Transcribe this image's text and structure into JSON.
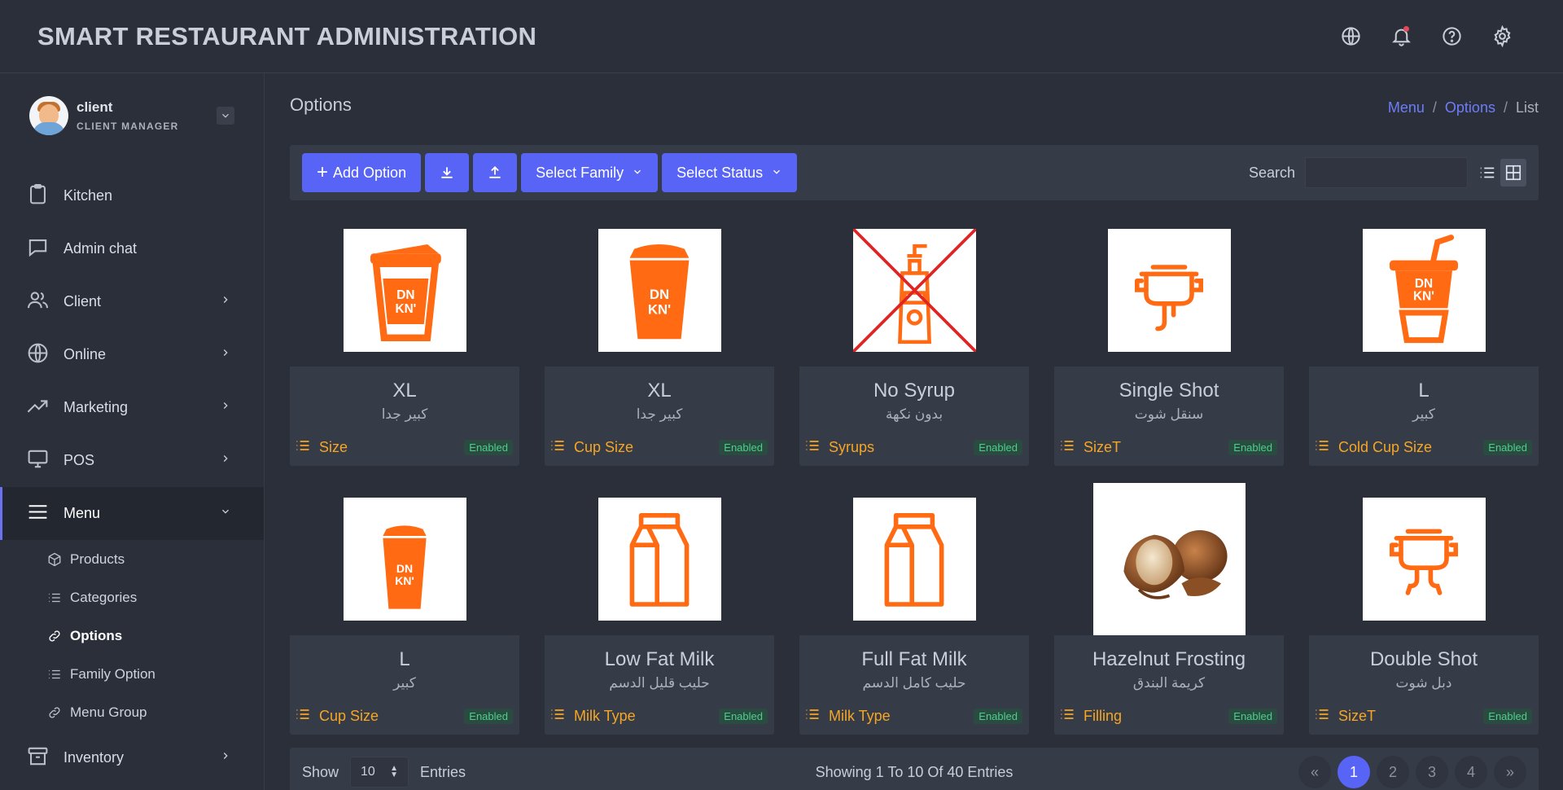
{
  "app": {
    "title": "SMART RESTAURANT ADMINISTRATION"
  },
  "header": {
    "icons": [
      "globe-icon",
      "bell-icon",
      "help-icon",
      "gear-icon"
    ]
  },
  "user": {
    "name": "client",
    "role": "CLIENT MANAGER"
  },
  "sidebar": {
    "items": [
      {
        "label": "Kitchen",
        "icon": "clipboard-icon",
        "chevron": false
      },
      {
        "label": "Admin chat",
        "icon": "chat-icon",
        "chevron": false
      },
      {
        "label": "Client",
        "icon": "users-icon",
        "chevron": true
      },
      {
        "label": "Online",
        "icon": "globe-icon",
        "chevron": true
      },
      {
        "label": "Marketing",
        "icon": "trend-icon",
        "chevron": true
      },
      {
        "label": "POS",
        "icon": "monitor-icon",
        "chevron": true
      },
      {
        "label": "Menu",
        "icon": "menu-icon",
        "chevron": true,
        "active": true
      },
      {
        "label": "Inventory",
        "icon": "archive-icon",
        "chevron": true
      }
    ],
    "menu_sub": [
      {
        "label": "Products",
        "icon": "box-icon"
      },
      {
        "label": "Categories",
        "icon": "list-icon"
      },
      {
        "label": "Options",
        "icon": "link-icon",
        "current": true
      },
      {
        "label": "Family Option",
        "icon": "list-icon"
      },
      {
        "label": "Menu Group",
        "icon": "link-icon"
      }
    ]
  },
  "page": {
    "title": "Options",
    "breadcrumb": {
      "first": "Menu",
      "second": "Options",
      "current": "List",
      "sep": "/"
    }
  },
  "toolbar": {
    "add_label": "Add Option",
    "family_label": "Select Family",
    "status_label": "Select Status",
    "search_label": "Search",
    "search_value": ""
  },
  "cards": [
    {
      "name": "XL",
      "ar": "كبير جدا",
      "family": "Size",
      "status": "Enabled",
      "image": "cup-lid-icon"
    },
    {
      "name": "XL",
      "ar": "كبير جدا",
      "family": "Cup Size",
      "status": "Enabled",
      "image": "cup-solid-icon"
    },
    {
      "name": "No Syrup",
      "ar": "بدون نكهة",
      "family": "Syrups",
      "status": "Enabled",
      "image": "no-syrup-icon"
    },
    {
      "name": "Single Shot",
      "ar": "سنقل شوت",
      "family": "SizeT",
      "status": "Enabled",
      "image": "single-shot-icon"
    },
    {
      "name": "L",
      "ar": "كبير",
      "family": "Cold Cup Size",
      "status": "Enabled",
      "image": "cold-cup-icon"
    },
    {
      "name": "L",
      "ar": "كبير",
      "family": "Cup Size",
      "status": "Enabled",
      "image": "cup-small-icon"
    },
    {
      "name": "Low Fat Milk",
      "ar": "حليب قليل الدسم",
      "family": "Milk Type",
      "status": "Enabled",
      "image": "milk-carton-icon"
    },
    {
      "name": "Full Fat Milk",
      "ar": "حليب كامل الدسم",
      "family": "Milk Type",
      "status": "Enabled",
      "image": "milk-carton-icon"
    },
    {
      "name": "Hazelnut Frosting",
      "ar": "كريمة البندق",
      "family": "Filling",
      "status": "Enabled",
      "image": "hazelnut-photo"
    },
    {
      "name": "Double Shot",
      "ar": "دبل شوت",
      "family": "SizeT",
      "status": "Enabled",
      "image": "double-shot-icon"
    }
  ],
  "footer": {
    "show_label": "Show",
    "page_size": "10",
    "entries_label": "Entries",
    "showing_text": "Showing 1 To 10 Of 40 Entries",
    "pages": [
      "«",
      "1",
      "2",
      "3",
      "4",
      "»"
    ],
    "current_page": "1"
  },
  "colors": {
    "accent": "#5864f5",
    "brand_orange": "#ff6a13",
    "family_text": "#f5a623",
    "status_green": "#4ccf8c",
    "background": "#2b2f3a",
    "card": "#363b48"
  }
}
